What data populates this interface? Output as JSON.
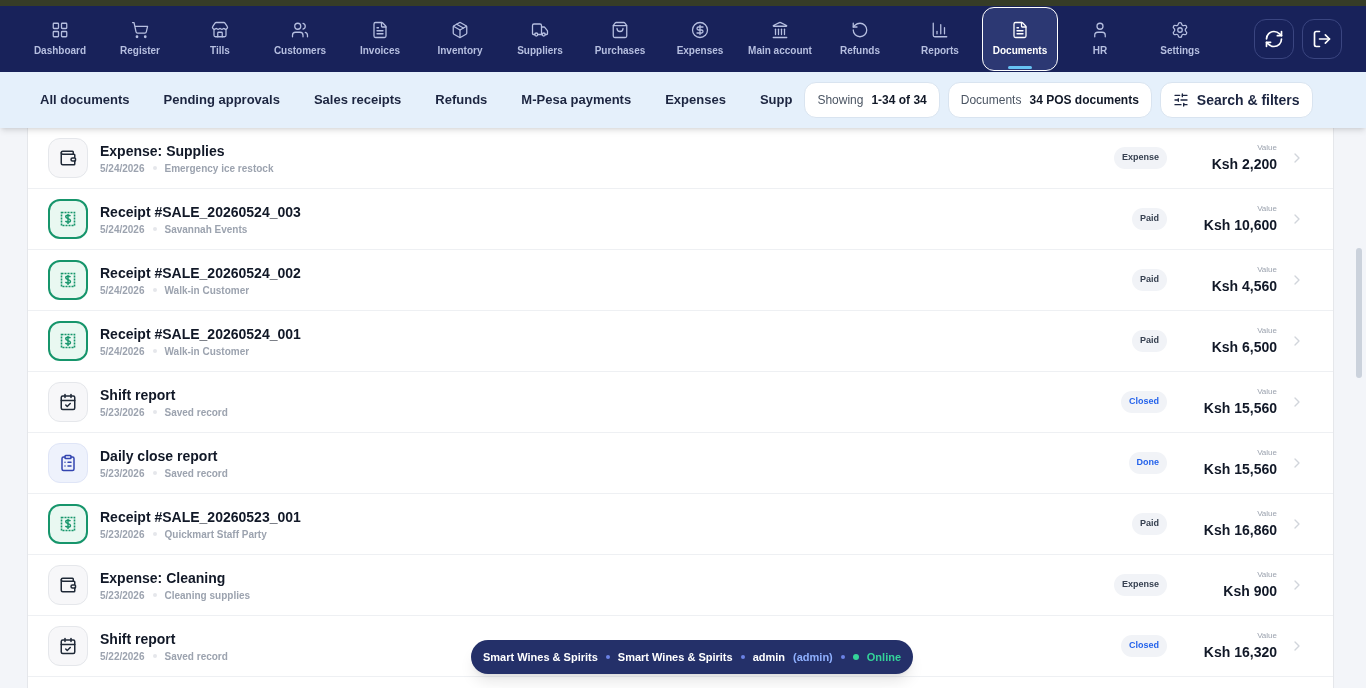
{
  "nav": {
    "items": [
      {
        "label": "Dashboard",
        "selected": false
      },
      {
        "label": "Register",
        "selected": false
      },
      {
        "label": "Tills",
        "selected": false
      },
      {
        "label": "Customers",
        "selected": false
      },
      {
        "label": "Invoices",
        "selected": false
      },
      {
        "label": "Inventory",
        "selected": false
      },
      {
        "label": "Suppliers",
        "selected": false
      },
      {
        "label": "Purchases",
        "selected": false
      },
      {
        "label": "Expenses",
        "selected": false
      },
      {
        "label": "Main account",
        "selected": false
      },
      {
        "label": "Refunds",
        "selected": false
      },
      {
        "label": "Reports",
        "selected": false
      },
      {
        "label": "Documents",
        "selected": true
      },
      {
        "label": "HR",
        "selected": false
      },
      {
        "label": "Settings",
        "selected": false
      }
    ]
  },
  "filters": {
    "tabs": [
      "All documents",
      "Pending approvals",
      "Sales receipts",
      "Refunds",
      "M-Pesa payments",
      "Expenses",
      "Supp"
    ],
    "showing": {
      "label": "Showing",
      "value": "1-34 of 34"
    },
    "documents": {
      "label": "Documents",
      "value": "34 POS documents"
    },
    "search_button": "Search & filters"
  },
  "documents": [
    {
      "kind": "expense",
      "title": "Expense: Supplies",
      "date": "5/24/2026",
      "note": "Emergency ice restock",
      "badge": {
        "text": "Expense",
        "color": "#374151"
      },
      "value_label": "Value",
      "value": "Ksh 2,200"
    },
    {
      "kind": "receipt",
      "title": "Receipt #SALE_20260524_003",
      "date": "5/24/2026",
      "note": "Savannah Events",
      "badge": {
        "text": "Paid",
        "color": "#374151"
      },
      "value_label": "Value",
      "value": "Ksh 10,600"
    },
    {
      "kind": "receipt",
      "title": "Receipt #SALE_20260524_002",
      "date": "5/24/2026",
      "note": "Walk-in Customer",
      "badge": {
        "text": "Paid",
        "color": "#374151"
      },
      "value_label": "Value",
      "value": "Ksh 4,560"
    },
    {
      "kind": "receipt",
      "title": "Receipt #SALE_20260524_001",
      "date": "5/24/2026",
      "note": "Walk-in Customer",
      "badge": {
        "text": "Paid",
        "color": "#374151"
      },
      "value_label": "Value",
      "value": "Ksh 6,500"
    },
    {
      "kind": "shift",
      "title": "Shift report",
      "date": "5/23/2026",
      "note": "Saved record",
      "badge": {
        "text": "Closed",
        "color": "#2563eb"
      },
      "value_label": "Value",
      "value": "Ksh 15,560"
    },
    {
      "kind": "daily",
      "title": "Daily close report",
      "date": "5/23/2026",
      "note": "Saved record",
      "badge": {
        "text": "Done",
        "color": "#2563eb"
      },
      "value_label": "Value",
      "value": "Ksh 15,560"
    },
    {
      "kind": "receipt",
      "title": "Receipt #SALE_20260523_001",
      "date": "5/23/2026",
      "note": "Quickmart Staff Party",
      "badge": {
        "text": "Paid",
        "color": "#374151"
      },
      "value_label": "Value",
      "value": "Ksh 16,860"
    },
    {
      "kind": "expense",
      "title": "Expense: Cleaning",
      "date": "5/23/2026",
      "note": "Cleaning supplies",
      "badge": {
        "text": "Expense",
        "color": "#374151"
      },
      "value_label": "Value",
      "value": "Ksh 900"
    },
    {
      "kind": "shift",
      "title": "Shift report",
      "date": "5/22/2026",
      "note": "Saved record",
      "badge": {
        "text": "Closed",
        "color": "#2563eb"
      },
      "value_label": "Value",
      "value": "Ksh 16,320"
    }
  ],
  "status_pill": {
    "store": "Smart Wines & Spirits",
    "branch": "Smart Wines & Spirits",
    "user": "admin",
    "role": "(admin)",
    "status": "Online"
  }
}
